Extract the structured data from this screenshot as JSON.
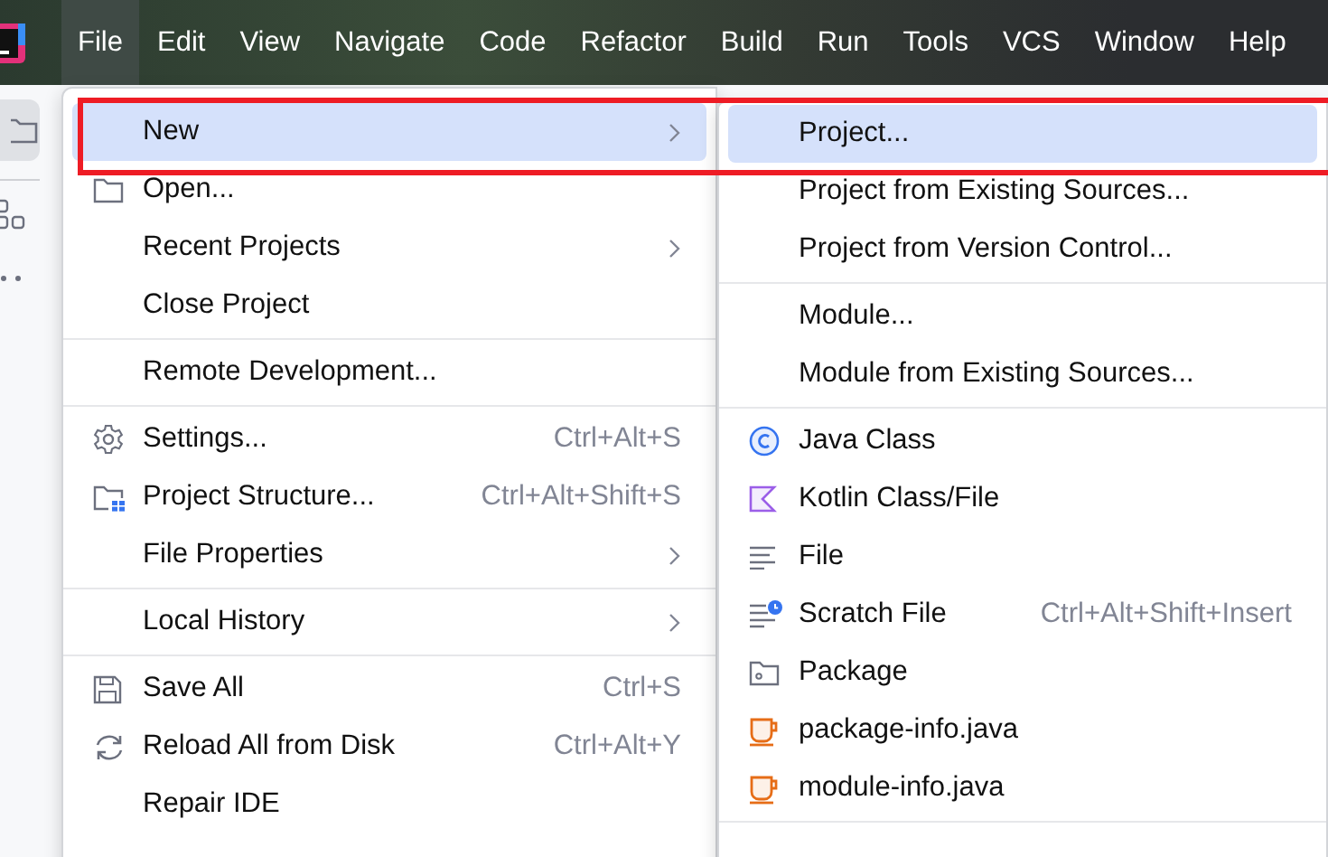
{
  "menubar": {
    "items": [
      {
        "label": "File",
        "selected": true
      },
      {
        "label": "Edit",
        "selected": false
      },
      {
        "label": "View",
        "selected": false
      },
      {
        "label": "Navigate",
        "selected": false
      },
      {
        "label": "Code",
        "selected": false
      },
      {
        "label": "Refactor",
        "selected": false
      },
      {
        "label": "Build",
        "selected": false
      },
      {
        "label": "Run",
        "selected": false
      },
      {
        "label": "Tools",
        "selected": false
      },
      {
        "label": "VCS",
        "selected": false
      },
      {
        "label": "Window",
        "selected": false
      },
      {
        "label": "Help",
        "selected": false
      }
    ]
  },
  "file_menu": {
    "items": [
      {
        "kind": "plain",
        "label": "New",
        "submenu": true,
        "selected": true
      },
      {
        "kind": "folder",
        "label": "Open...",
        "submenu": false,
        "selected": false
      },
      {
        "kind": "plain",
        "label": "Recent Projects",
        "submenu": true,
        "selected": false
      },
      {
        "kind": "plain",
        "label": "Close Project",
        "submenu": false,
        "selected": false
      },
      {
        "kind": "separator"
      },
      {
        "kind": "plain",
        "label": "Remote Development...",
        "submenu": false,
        "selected": false
      },
      {
        "kind": "separator"
      },
      {
        "kind": "gear",
        "label": "Settings...",
        "shortcut": "Ctrl+Alt+S",
        "submenu": false,
        "selected": false
      },
      {
        "kind": "structure",
        "label": "Project Structure...",
        "shortcut": "Ctrl+Alt+Shift+S",
        "submenu": false,
        "selected": false
      },
      {
        "kind": "plain",
        "label": "File Properties",
        "submenu": true,
        "selected": false
      },
      {
        "kind": "separator"
      },
      {
        "kind": "plain",
        "label": "Local History",
        "submenu": true,
        "selected": false
      },
      {
        "kind": "separator"
      },
      {
        "kind": "save",
        "label": "Save All",
        "shortcut": "Ctrl+S",
        "submenu": false,
        "selected": false
      },
      {
        "kind": "reload",
        "label": "Reload All from Disk",
        "shortcut": "Ctrl+Alt+Y",
        "submenu": false,
        "selected": false
      },
      {
        "kind": "plain",
        "label": "Repair IDE",
        "submenu": false,
        "selected": false
      }
    ]
  },
  "new_submenu": {
    "items": [
      {
        "kind": "plain",
        "label": "Project...",
        "selected": true
      },
      {
        "kind": "plain",
        "label": "Project from Existing Sources...",
        "selected": false
      },
      {
        "kind": "plain",
        "label": "Project from Version Control...",
        "selected": false
      },
      {
        "kind": "separator"
      },
      {
        "kind": "plain",
        "label": "Module...",
        "selected": false
      },
      {
        "kind": "plain",
        "label": "Module from Existing Sources...",
        "selected": false
      },
      {
        "kind": "separator"
      },
      {
        "kind": "class",
        "label": "Java Class",
        "selected": false
      },
      {
        "kind": "kotlin",
        "label": "Kotlin Class/File",
        "selected": false
      },
      {
        "kind": "text",
        "label": "File",
        "selected": false
      },
      {
        "kind": "scratch",
        "label": "Scratch File",
        "shortcut": "Ctrl+Alt+Shift+Insert",
        "selected": false
      },
      {
        "kind": "package",
        "label": "Package",
        "selected": false
      },
      {
        "kind": "cup",
        "label": "package-info.java",
        "selected": false
      },
      {
        "kind": "cup",
        "label": "module-info.java",
        "selected": false
      },
      {
        "kind": "separator"
      }
    ]
  }
}
